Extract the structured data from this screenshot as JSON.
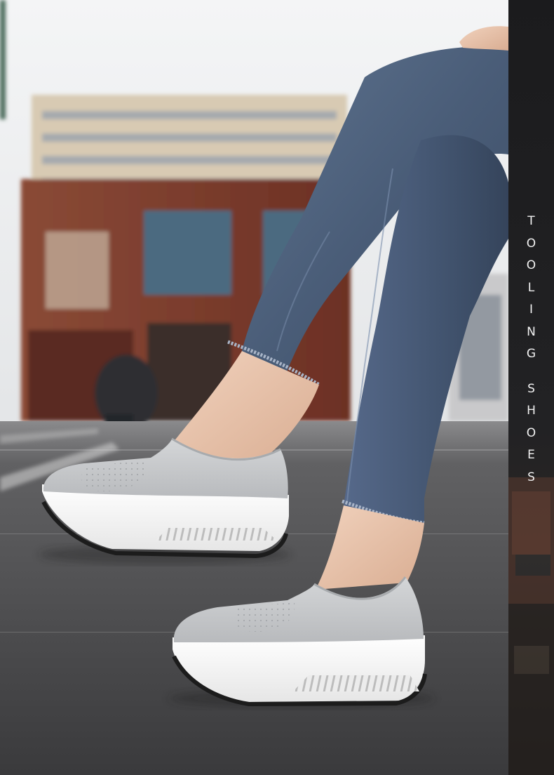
{
  "image": {
    "description_tag": "product lifestyle photo",
    "colors": {
      "sky": "#eceef0",
      "building_brick": "#7a3b2c",
      "building_pale": "#d9cbb4",
      "asphalt": "#48484a",
      "denim": "#4a5d78",
      "sneaker_upper": "#c9cbcd",
      "sole": "#f7f7f7",
      "side_band": "#1f1f21"
    }
  },
  "side_label": {
    "word1": [
      "T",
      "O",
      "O",
      "L",
      "I",
      "N",
      "G"
    ],
    "word2": [
      "S",
      "H",
      "O",
      "E",
      "S"
    ]
  }
}
